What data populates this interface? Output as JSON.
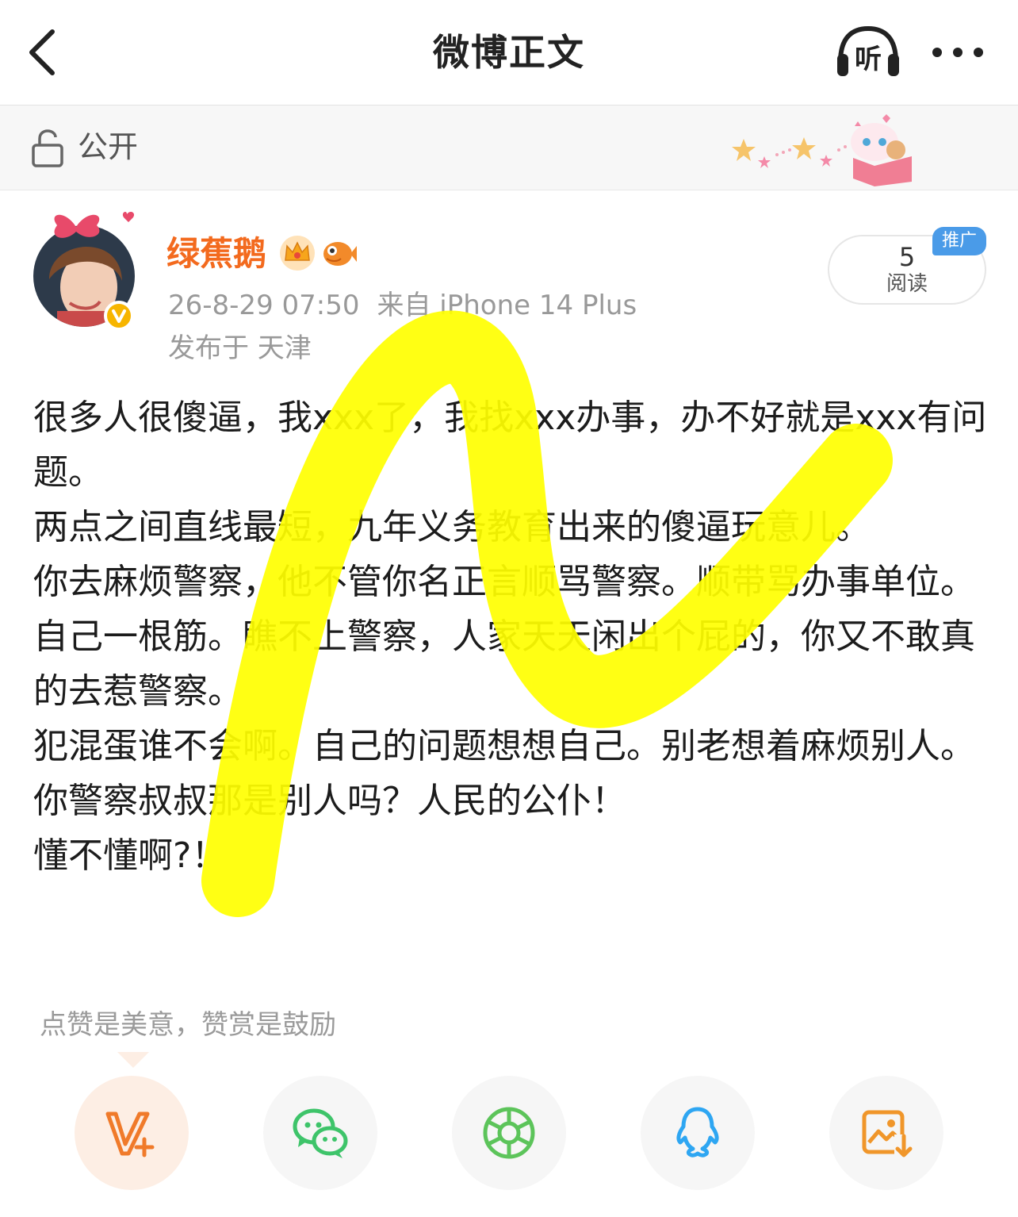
{
  "header": {
    "title": "微博正文"
  },
  "visibility": {
    "label": "公开"
  },
  "post": {
    "author": "绿蕉鹅",
    "time": "26-8-29 07:50",
    "source": "来自 iPhone 14 Plus",
    "location": "发布于 天津",
    "reads": {
      "count": "5",
      "label": "阅读"
    },
    "promo_badge": "推广",
    "paragraphs": [
      "很多人很傻逼，我xxx了，我找xxx办事，办不好就是xxx有问题。",
      "两点之间直线最短，九年义务教育出来的傻逼玩意儿。",
      "你去麻烦警察，他不管你名正言顺骂警察。顺带骂办事单位。",
      "自己一根筋。瞧不上警察，人家天天闲出个屁的，你又不敢真的去惹警察。",
      "犯混蛋谁不会啊。自己的问题想想自己。别老想着麻烦别人。你警察叔叔那是别人吗？人民的公仆！",
      "懂不懂啊?！"
    ]
  },
  "reward_tip": "点赞是美意，赞赏是鼓励",
  "actions": [
    {
      "icon": "v-plus-icon",
      "color": "#f07a2a"
    },
    {
      "icon": "wechat-icon",
      "color": "#3ec46a"
    },
    {
      "icon": "moments-icon",
      "color": "#5cc45a"
    },
    {
      "icon": "qq-icon",
      "color": "#2ea6f2"
    },
    {
      "icon": "save-image-icon",
      "color": "#f0962a"
    }
  ]
}
